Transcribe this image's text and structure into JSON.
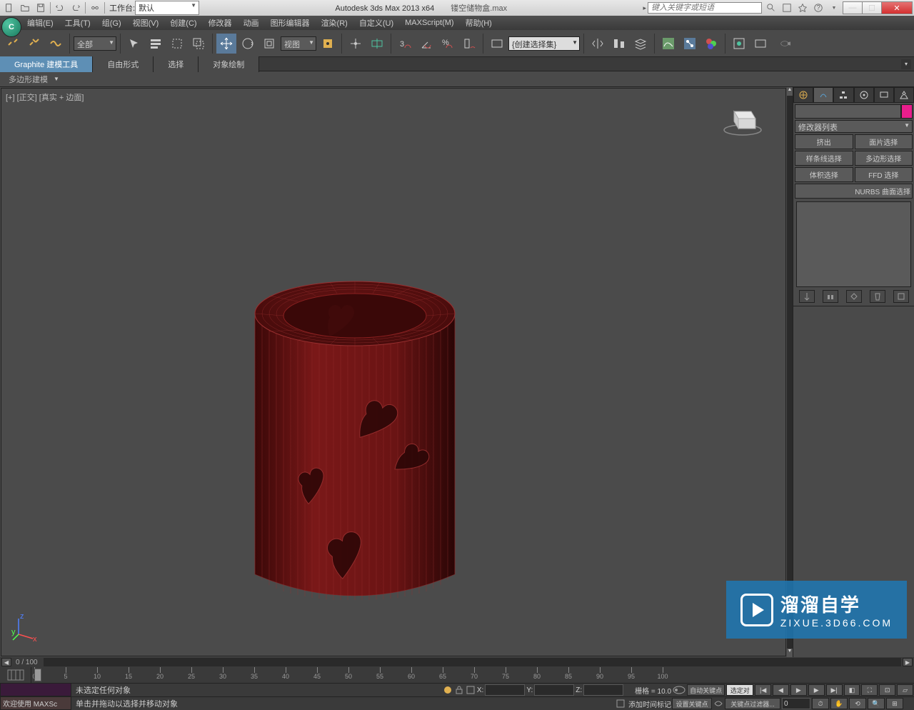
{
  "titlebar": {
    "workspace_label": "工作台:",
    "workspace_value": "默认",
    "app_title": "Autodesk 3ds Max  2013 x64",
    "filename": "镂空储物盒.max",
    "search_placeholder": "键入关键字或短语"
  },
  "menubar": {
    "items": [
      "编辑(E)",
      "工具(T)",
      "组(G)",
      "视图(V)",
      "创建(C)",
      "修改器",
      "动画",
      "图形编辑器",
      "渲染(R)",
      "自定义(U)",
      "MAXScript(M)",
      "帮助(H)"
    ]
  },
  "toolbar": {
    "filter_dd": "全部",
    "view_dd": "视图",
    "selset_dd": "{创建选择集}"
  },
  "ribbon": {
    "tabs": [
      "Graphite 建模工具",
      "自由形式",
      "选择",
      "对象绘制"
    ],
    "sub": "多边形建模"
  },
  "viewport": {
    "label": "[+] [正交] [真实 + 边面]"
  },
  "cmd_panel": {
    "modifier_list": "修改器列表",
    "buttons": [
      "挤出",
      "面片选择",
      "样条线选择",
      "多边形选择",
      "体积选择",
      "FFD 选择",
      "NURBS 曲面选择"
    ]
  },
  "timeline": {
    "position": "0 / 100",
    "ticks": [
      0,
      5,
      10,
      15,
      20,
      25,
      30,
      35,
      40,
      45,
      50,
      55,
      60,
      65,
      70,
      75,
      80,
      85,
      90,
      95,
      100
    ]
  },
  "status": {
    "welcome": "欢迎使用  MAXSc",
    "msg1": "未选定任何对象",
    "msg2": "单击并拖动以选择并移动对象",
    "grid_label": "栅格 = 10.0",
    "add_time": "添加时间标记",
    "auto_key": "自动关键点",
    "set_key": "设置关键点",
    "selected": "选定对",
    "key_filter": "关键点过滤器..."
  },
  "coords": {
    "x": "X:",
    "y": "Y:",
    "z": "Z:"
  },
  "watermark": {
    "title": "溜溜自学",
    "sub": "ZIXUE.3D66.COM"
  }
}
